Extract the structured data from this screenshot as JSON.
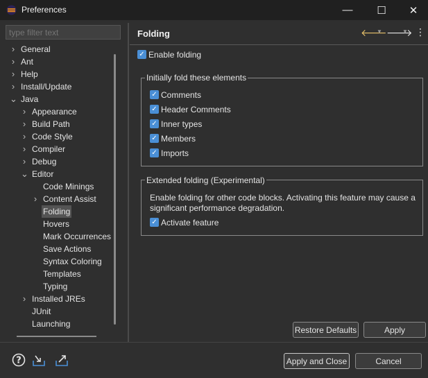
{
  "window": {
    "title": "Preferences",
    "minimize": "—",
    "maximize": "☐",
    "close": "✕"
  },
  "filter": {
    "placeholder": "type filter text"
  },
  "tree": [
    {
      "label": "General",
      "indent": 0,
      "arrow": "›"
    },
    {
      "label": "Ant",
      "indent": 0,
      "arrow": "›"
    },
    {
      "label": "Help",
      "indent": 0,
      "arrow": "›"
    },
    {
      "label": "Install/Update",
      "indent": 0,
      "arrow": "›"
    },
    {
      "label": "Java",
      "indent": 0,
      "arrow": "⌄"
    },
    {
      "label": "Appearance",
      "indent": 1,
      "arrow": "›"
    },
    {
      "label": "Build Path",
      "indent": 1,
      "arrow": "›"
    },
    {
      "label": "Code Style",
      "indent": 1,
      "arrow": "›"
    },
    {
      "label": "Compiler",
      "indent": 1,
      "arrow": "›"
    },
    {
      "label": "Debug",
      "indent": 1,
      "arrow": "›"
    },
    {
      "label": "Editor",
      "indent": 1,
      "arrow": "⌄"
    },
    {
      "label": "Code Minings",
      "indent": 2,
      "arrow": ""
    },
    {
      "label": "Content Assist",
      "indent": 2,
      "arrow": "›"
    },
    {
      "label": "Folding",
      "indent": 2,
      "arrow": "",
      "selected": true
    },
    {
      "label": "Hovers",
      "indent": 2,
      "arrow": ""
    },
    {
      "label": "Mark Occurrences",
      "indent": 2,
      "arrow": ""
    },
    {
      "label": "Save Actions",
      "indent": 2,
      "arrow": ""
    },
    {
      "label": "Syntax Coloring",
      "indent": 2,
      "arrow": ""
    },
    {
      "label": "Templates",
      "indent": 2,
      "arrow": ""
    },
    {
      "label": "Typing",
      "indent": 2,
      "arrow": ""
    },
    {
      "label": "Installed JREs",
      "indent": 1,
      "arrow": "›"
    },
    {
      "label": "JUnit",
      "indent": 1,
      "arrow": ""
    },
    {
      "label": "Launching",
      "indent": 1,
      "arrow": ""
    }
  ],
  "page": {
    "title": "Folding",
    "enable_folding": {
      "label": "Enable folding",
      "checked": true
    },
    "initial_group": {
      "title": "Initially fold these elements",
      "items": [
        {
          "label": "Comments",
          "checked": true
        },
        {
          "label": "Header Comments",
          "checked": true
        },
        {
          "label": "Inner types",
          "checked": true
        },
        {
          "label": "Members",
          "checked": true
        },
        {
          "label": "Imports",
          "checked": true
        }
      ]
    },
    "extended_group": {
      "title": "Extended folding (Experimental)",
      "description": "Enable folding for other code blocks. Activating this feature may cause a significant performance degradation.",
      "activate": {
        "label": "Activate feature",
        "checked": true
      }
    },
    "restore_defaults": "Restore Defaults",
    "apply": "Apply"
  },
  "footer": {
    "apply_and_close": "Apply and Close",
    "cancel": "Cancel",
    "icons": [
      "help-icon",
      "import-icon",
      "export-icon"
    ]
  },
  "colors": {
    "accent": "#4a8fd6",
    "nav_arrow": "#e8c26a",
    "background": "#2f2f2f"
  }
}
